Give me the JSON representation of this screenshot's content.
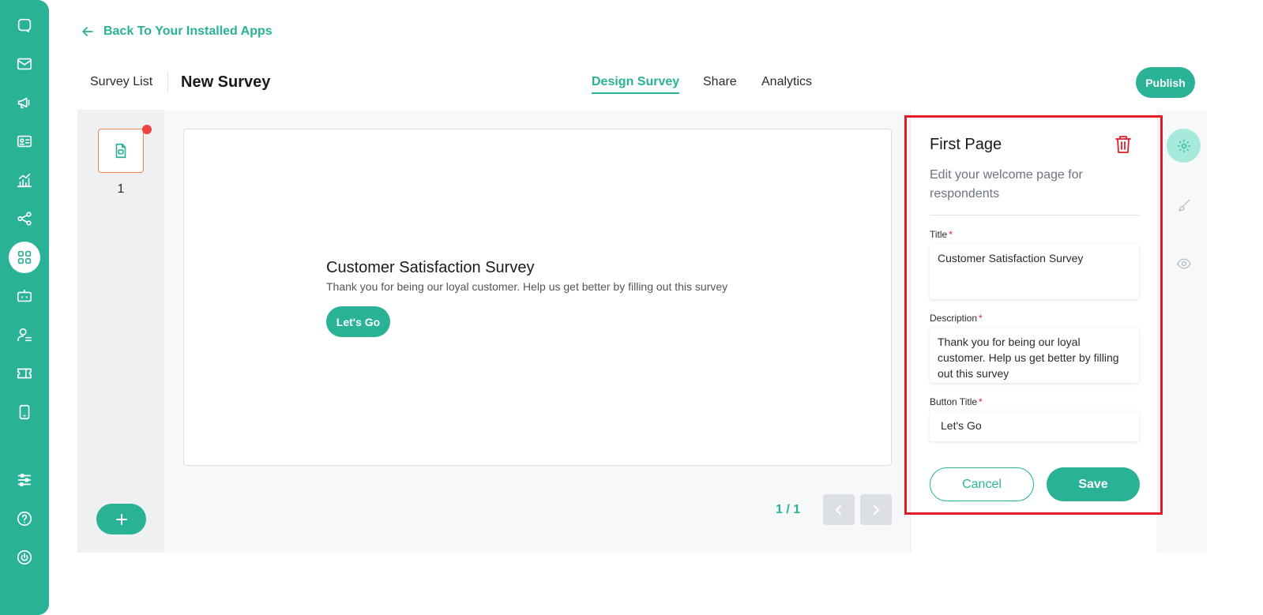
{
  "back_link": "Back To Your Installed Apps",
  "breadcrumb": {
    "list": "Survey List",
    "current": "New Survey"
  },
  "tabs": [
    {
      "label": "Design Survey",
      "active": true
    },
    {
      "label": "Share",
      "active": false
    },
    {
      "label": "Analytics",
      "active": false
    }
  ],
  "publish_label": "Publish",
  "pages": [
    {
      "number": "1",
      "has_notification": true
    }
  ],
  "preview": {
    "title": "Customer Satisfaction Survey",
    "description": "Thank you for being our loyal customer. Help us get better by filling out this survey",
    "button": "Let's Go"
  },
  "pager": {
    "text": "1 / 1"
  },
  "panel": {
    "title": "First Page",
    "subtitle": "Edit your welcome page for respondents",
    "fields": {
      "title_label": "Title",
      "title_value": "Customer Satisfaction Survey",
      "description_label": "Description",
      "description_value": "Thank you for being our loyal customer. Help us get better by filling out this survey",
      "button_label": "Button Title",
      "button_value": "Let's Go"
    },
    "cancel": "Cancel",
    "save": "Save"
  },
  "colors": {
    "accent": "#29b295",
    "danger": "#e11d2a",
    "highlight_frame": "#e11d2a",
    "page_thumb_border": "#f0884a"
  },
  "icons": {
    "sidebar": [
      "chat-icon",
      "mail-icon",
      "megaphone-icon",
      "contact-card-icon",
      "bar-chart-icon",
      "share-nodes-icon",
      "apps-grid-icon",
      "bot-icon",
      "user-list-icon",
      "ticket-icon",
      "mobile-icon",
      "settings-sliders-icon",
      "help-icon",
      "power-icon"
    ],
    "side_tools": [
      "gear-icon",
      "brush-icon",
      "eye-icon"
    ]
  }
}
